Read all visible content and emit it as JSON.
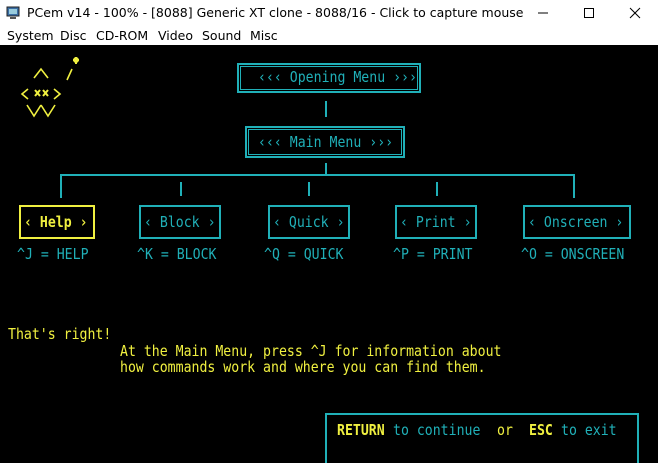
{
  "window": {
    "title": "PCem v14 - 100% - [8088] Generic XT clone - 8088/16 - Click to capture mouse"
  },
  "menubar": {
    "items": [
      "System",
      "Disc",
      "CD-ROM",
      "Video",
      "Sound",
      "Misc"
    ]
  },
  "screen": {
    "opening_menu": "‹‹‹ Opening Menu ›››",
    "main_menu": "‹‹‹ Main Menu ›››",
    "menus": [
      {
        "label": "‹ Help ›",
        "shortcut": "^J = HELP"
      },
      {
        "label": "‹ Block ›",
        "shortcut": "^K = BLOCK"
      },
      {
        "label": "‹ Quick ›",
        "shortcut": "^Q = QUICK"
      },
      {
        "label": "‹ Print ›",
        "shortcut": "^P = PRINT"
      },
      {
        "label": "‹ Onscreen ›",
        "shortcut": "^O = ONSCREEN"
      }
    ],
    "message_head": "That's right!",
    "message_line1": "At the Main Menu, press ^J for information about",
    "message_line2": "how commands work and where you can find them.",
    "footer": {
      "return_key": "RETURN",
      "to_continue": "to continue",
      "or": "or",
      "esc_key": "ESC",
      "to_exit": "to exit"
    },
    "colors": {
      "cyan": "#20b0b8",
      "yellow": "#f0f040",
      "background": "#000000"
    }
  }
}
